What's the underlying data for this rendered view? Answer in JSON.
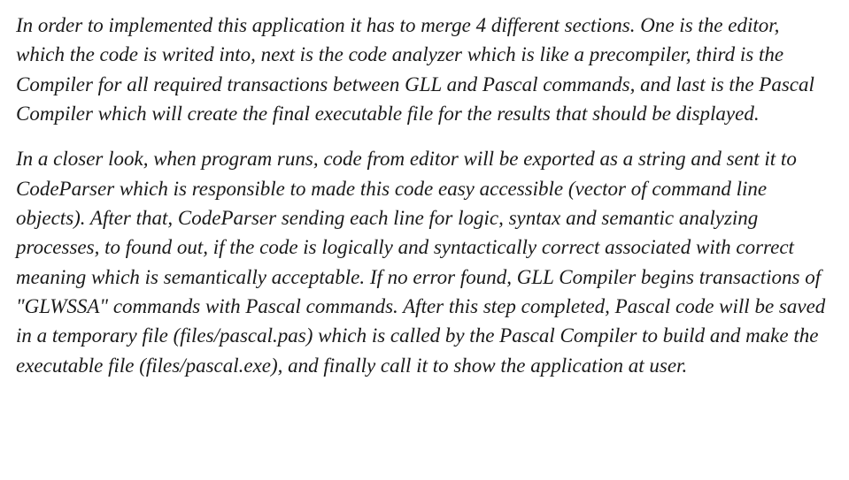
{
  "document": {
    "paragraphs": [
      "In order to implemented this application it has to merge 4 different sections. One is the editor, which the code is writed into, next is the code analyzer which is like a precompiler, third is the Compiler for all required transactions between GLL and Pascal commands, and last is the Pascal Compiler which will create the final executable file for the results that should be displayed.",
      "In a closer look, when program runs, code from editor will be exported as a string and sent it to CodeParser which is responsible to made this code easy accessible (vector of command line objects). After that, CodeParser sending each line for logic, syntax and semantic analyzing processes, to found out, if the code is logically and syntactically correct associated with correct meaning which is semantically acceptable. If no error found, GLL Compiler begins transactions of \"GLWSSA\" commands with Pascal commands. After this step completed, Pascal code will be saved in a temporary file (files/pascal.pas) which is called by the Pascal Compiler to build and make the executable file (files/pascal.exe), and finally call it to show the application at user."
    ]
  }
}
